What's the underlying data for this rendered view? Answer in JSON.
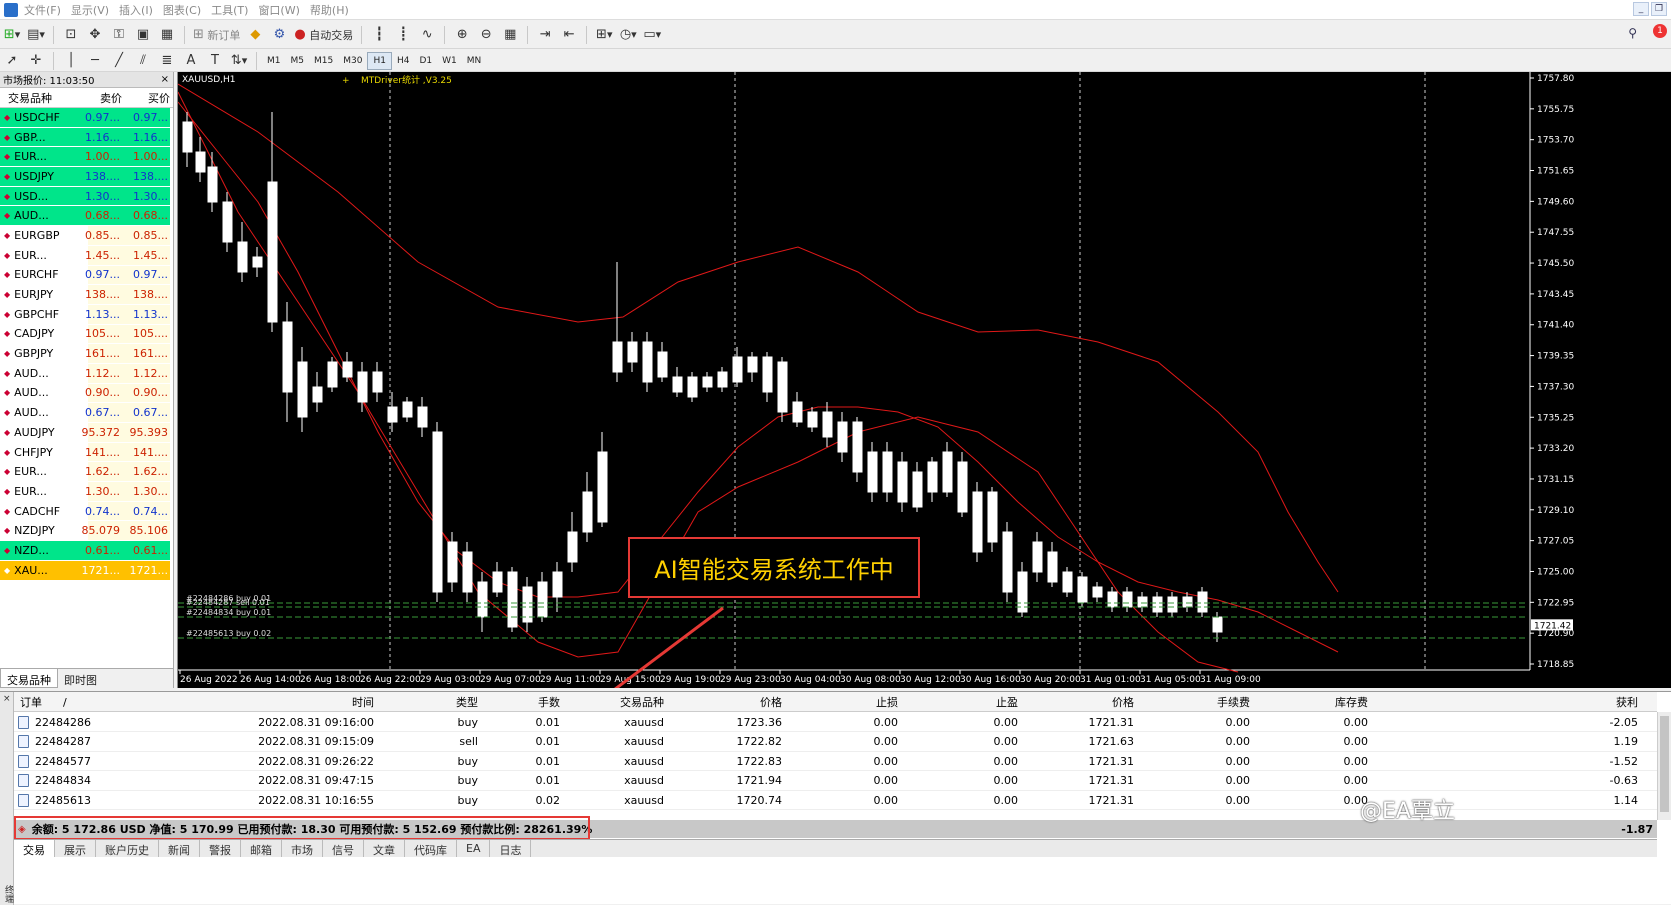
{
  "menu": [
    "文件(F)",
    "显示(V)",
    "插入(I)",
    "图表(C)",
    "工具(T)",
    "窗口(W)",
    "帮助(H)"
  ],
  "toolbar": {
    "new_order": "新订单",
    "auto_trade": "自动交易",
    "timeframes": [
      "M1",
      "M5",
      "M15",
      "M30",
      "H1",
      "H4",
      "D1",
      "W1",
      "MN"
    ],
    "active_timeframe": "H1",
    "notification_count": "1"
  },
  "market_watch": {
    "title": "市场报价: 11:03:50",
    "col_symbol": "交易品种",
    "col_bid": "卖价",
    "col_ask": "买价",
    "rows": [
      {
        "symbol": "USDCHF",
        "bid": "0.97...",
        "ask": "0.97...",
        "bg": "#00e58a",
        "color": "#1133cc"
      },
      {
        "symbol": "GBP...",
        "bid": "1.16...",
        "ask": "1.16...",
        "bg": "#00e58a",
        "color": "#1133cc"
      },
      {
        "symbol": "EUR...",
        "bid": "1.00...",
        "ask": "1.00...",
        "bg": "#00e58a",
        "color": "#cc2200"
      },
      {
        "symbol": "USDJPY",
        "bid": "138....",
        "ask": "138....",
        "bg": "#00e58a",
        "color": "#1133cc"
      },
      {
        "symbol": "USD...",
        "bid": "1.30...",
        "ask": "1.30...",
        "bg": "#00e58a",
        "color": "#1133cc"
      },
      {
        "symbol": "AUD...",
        "bid": "0.68...",
        "ask": "0.68...",
        "bg": "#00e58a",
        "color": "#cc2200"
      },
      {
        "symbol": "EURGBP",
        "bid": "0.85...",
        "ask": "0.85...",
        "bg": "#fffbe0",
        "color": "#cc2200"
      },
      {
        "symbol": "EUR...",
        "bid": "1.45...",
        "ask": "1.45...",
        "bg": "#fffbe0",
        "color": "#cc2200"
      },
      {
        "symbol": "EURCHF",
        "bid": "0.97...",
        "ask": "0.97...",
        "bg": "#fffbe0",
        "color": "#1133cc"
      },
      {
        "symbol": "EURJPY",
        "bid": "138....",
        "ask": "138....",
        "bg": "#fffbe0",
        "color": "#cc2200"
      },
      {
        "symbol": "GBPCHF",
        "bid": "1.13...",
        "ask": "1.13...",
        "bg": "#fffbe0",
        "color": "#1133cc"
      },
      {
        "symbol": "CADJPY",
        "bid": "105....",
        "ask": "105....",
        "bg": "#fffbe0",
        "color": "#cc2200"
      },
      {
        "symbol": "GBPJPY",
        "bid": "161....",
        "ask": "161....",
        "bg": "#fffbe0",
        "color": "#cc2200"
      },
      {
        "symbol": "AUD...",
        "bid": "1.12...",
        "ask": "1.12...",
        "bg": "#fffbe0",
        "color": "#cc2200"
      },
      {
        "symbol": "AUD...",
        "bid": "0.90...",
        "ask": "0.90...",
        "bg": "#fffbe0",
        "color": "#cc2200"
      },
      {
        "symbol": "AUD...",
        "bid": "0.67...",
        "ask": "0.67...",
        "bg": "#fffbe0",
        "color": "#1133cc"
      },
      {
        "symbol": "AUDJPY",
        "bid": "95.372",
        "ask": "95.393",
        "bg": "#fffbe0",
        "color": "#cc2200"
      },
      {
        "symbol": "CHFJPY",
        "bid": "141....",
        "ask": "141....",
        "bg": "#fffbe0",
        "color": "#cc2200"
      },
      {
        "symbol": "EUR...",
        "bid": "1.62...",
        "ask": "1.62...",
        "bg": "#fffbe0",
        "color": "#cc2200"
      },
      {
        "symbol": "EUR...",
        "bid": "1.30...",
        "ask": "1.30...",
        "bg": "#fffbe0",
        "color": "#cc2200"
      },
      {
        "symbol": "CADCHF",
        "bid": "0.74...",
        "ask": "0.74...",
        "bg": "#fffbe0",
        "color": "#1133cc"
      },
      {
        "symbol": "NZDJPY",
        "bid": "85.079",
        "ask": "85.106",
        "bg": "#fffbe0",
        "color": "#cc2200"
      },
      {
        "symbol": "NZD...",
        "bid": "0.61...",
        "ask": "0.61...",
        "bg": "#00e58a",
        "color": "#cc2200"
      },
      {
        "symbol": "XAU...",
        "bid": "1721...",
        "ask": "1721...",
        "bg": "#ffc000",
        "color": "#ffffff"
      }
    ],
    "tabs": [
      "交易品种",
      "即时图"
    ]
  },
  "chart": {
    "label": "XAUUSD,H1",
    "indicator": "MTDriver统计 ,V3.25",
    "ai_banner": "AI智能交易系统工作中",
    "price_labels": [
      "1757.80",
      "1755.75",
      "1753.70",
      "1751.65",
      "1749.60",
      "1747.55",
      "1745.50",
      "1743.45",
      "1741.40",
      "1739.35",
      "1737.30",
      "1735.25",
      "1733.20",
      "1731.15",
      "1729.10",
      "1727.05",
      "1725.00",
      "1722.95",
      "1720.90",
      "1718.85"
    ],
    "current_price": "1721.42",
    "time_labels": [
      "26 Aug 2022",
      "26 Aug 14:00",
      "26 Aug 18:00",
      "26 Aug 22:00",
      "29 Aug 03:00",
      "29 Aug 07:00",
      "29 Aug 11:00",
      "29 Aug 15:00",
      "29 Aug 19:00",
      "29 Aug 23:00",
      "30 Aug 04:00",
      "30 Aug 08:00",
      "30 Aug 12:00",
      "30 Aug 16:00",
      "30 Aug 20:00",
      "31 Aug 01:00",
      "31 Aug 05:00",
      "31 Aug 09:00"
    ],
    "order_lines": [
      "#22484286 buy 0.01",
      "#22484287 sell 0.01",
      "#22484834 buy 0.01",
      "#22485613 buy 0.02"
    ]
  },
  "terminal": {
    "columns": [
      "订单",
      "时间",
      "类型",
      "手数",
      "交易品种",
      "价格",
      "止损",
      "止盈",
      "价格",
      "手续费",
      "库存费",
      "获利"
    ],
    "rows": [
      {
        "order": "22484286",
        "time": "2022.08.31 09:16:00",
        "type": "buy",
        "lots": "0.01",
        "symbol": "xauusd",
        "price": "1723.36",
        "sl": "0.00",
        "tp": "0.00",
        "cur": "1721.31",
        "comm": "0.00",
        "swap": "0.00",
        "profit": "-2.05"
      },
      {
        "order": "22484287",
        "time": "2022.08.31 09:15:09",
        "type": "sell",
        "lots": "0.01",
        "symbol": "xauusd",
        "price": "1722.82",
        "sl": "0.00",
        "tp": "0.00",
        "cur": "1721.63",
        "comm": "0.00",
        "swap": "0.00",
        "profit": "1.19"
      },
      {
        "order": "22484577",
        "time": "2022.08.31 09:26:22",
        "type": "buy",
        "lots": "0.01",
        "symbol": "xauusd",
        "price": "1722.83",
        "sl": "0.00",
        "tp": "0.00",
        "cur": "1721.31",
        "comm": "0.00",
        "swap": "0.00",
        "profit": "-1.52"
      },
      {
        "order": "22484834",
        "time": "2022.08.31 09:47:15",
        "type": "buy",
        "lots": "0.01",
        "symbol": "xauusd",
        "price": "1721.94",
        "sl": "0.00",
        "tp": "0.00",
        "cur": "1721.31",
        "comm": "0.00",
        "swap": "0.00",
        "profit": "-0.63"
      },
      {
        "order": "22485613",
        "time": "2022.08.31 10:16:55",
        "type": "buy",
        "lots": "0.02",
        "symbol": "xauusd",
        "price": "1720.74",
        "sl": "0.00",
        "tp": "0.00",
        "cur": "1721.31",
        "comm": "0.00",
        "swap": "0.00",
        "profit": "1.14"
      }
    ],
    "balance_line": "余额: 5 172.86 USD  净值: 5 170.99  已用预付款: 18.30  可用预付款: 5 152.69  预付款比例: 28261.39%",
    "total_profit": "-1.87",
    "tabs": [
      "交易",
      "展示",
      "账户历史",
      "新闻",
      "警报",
      "邮箱",
      "市场",
      "信号",
      "文章",
      "代码库",
      "EA",
      "日志"
    ],
    "side_label": "终端"
  },
  "watermark": "@EA覃立"
}
